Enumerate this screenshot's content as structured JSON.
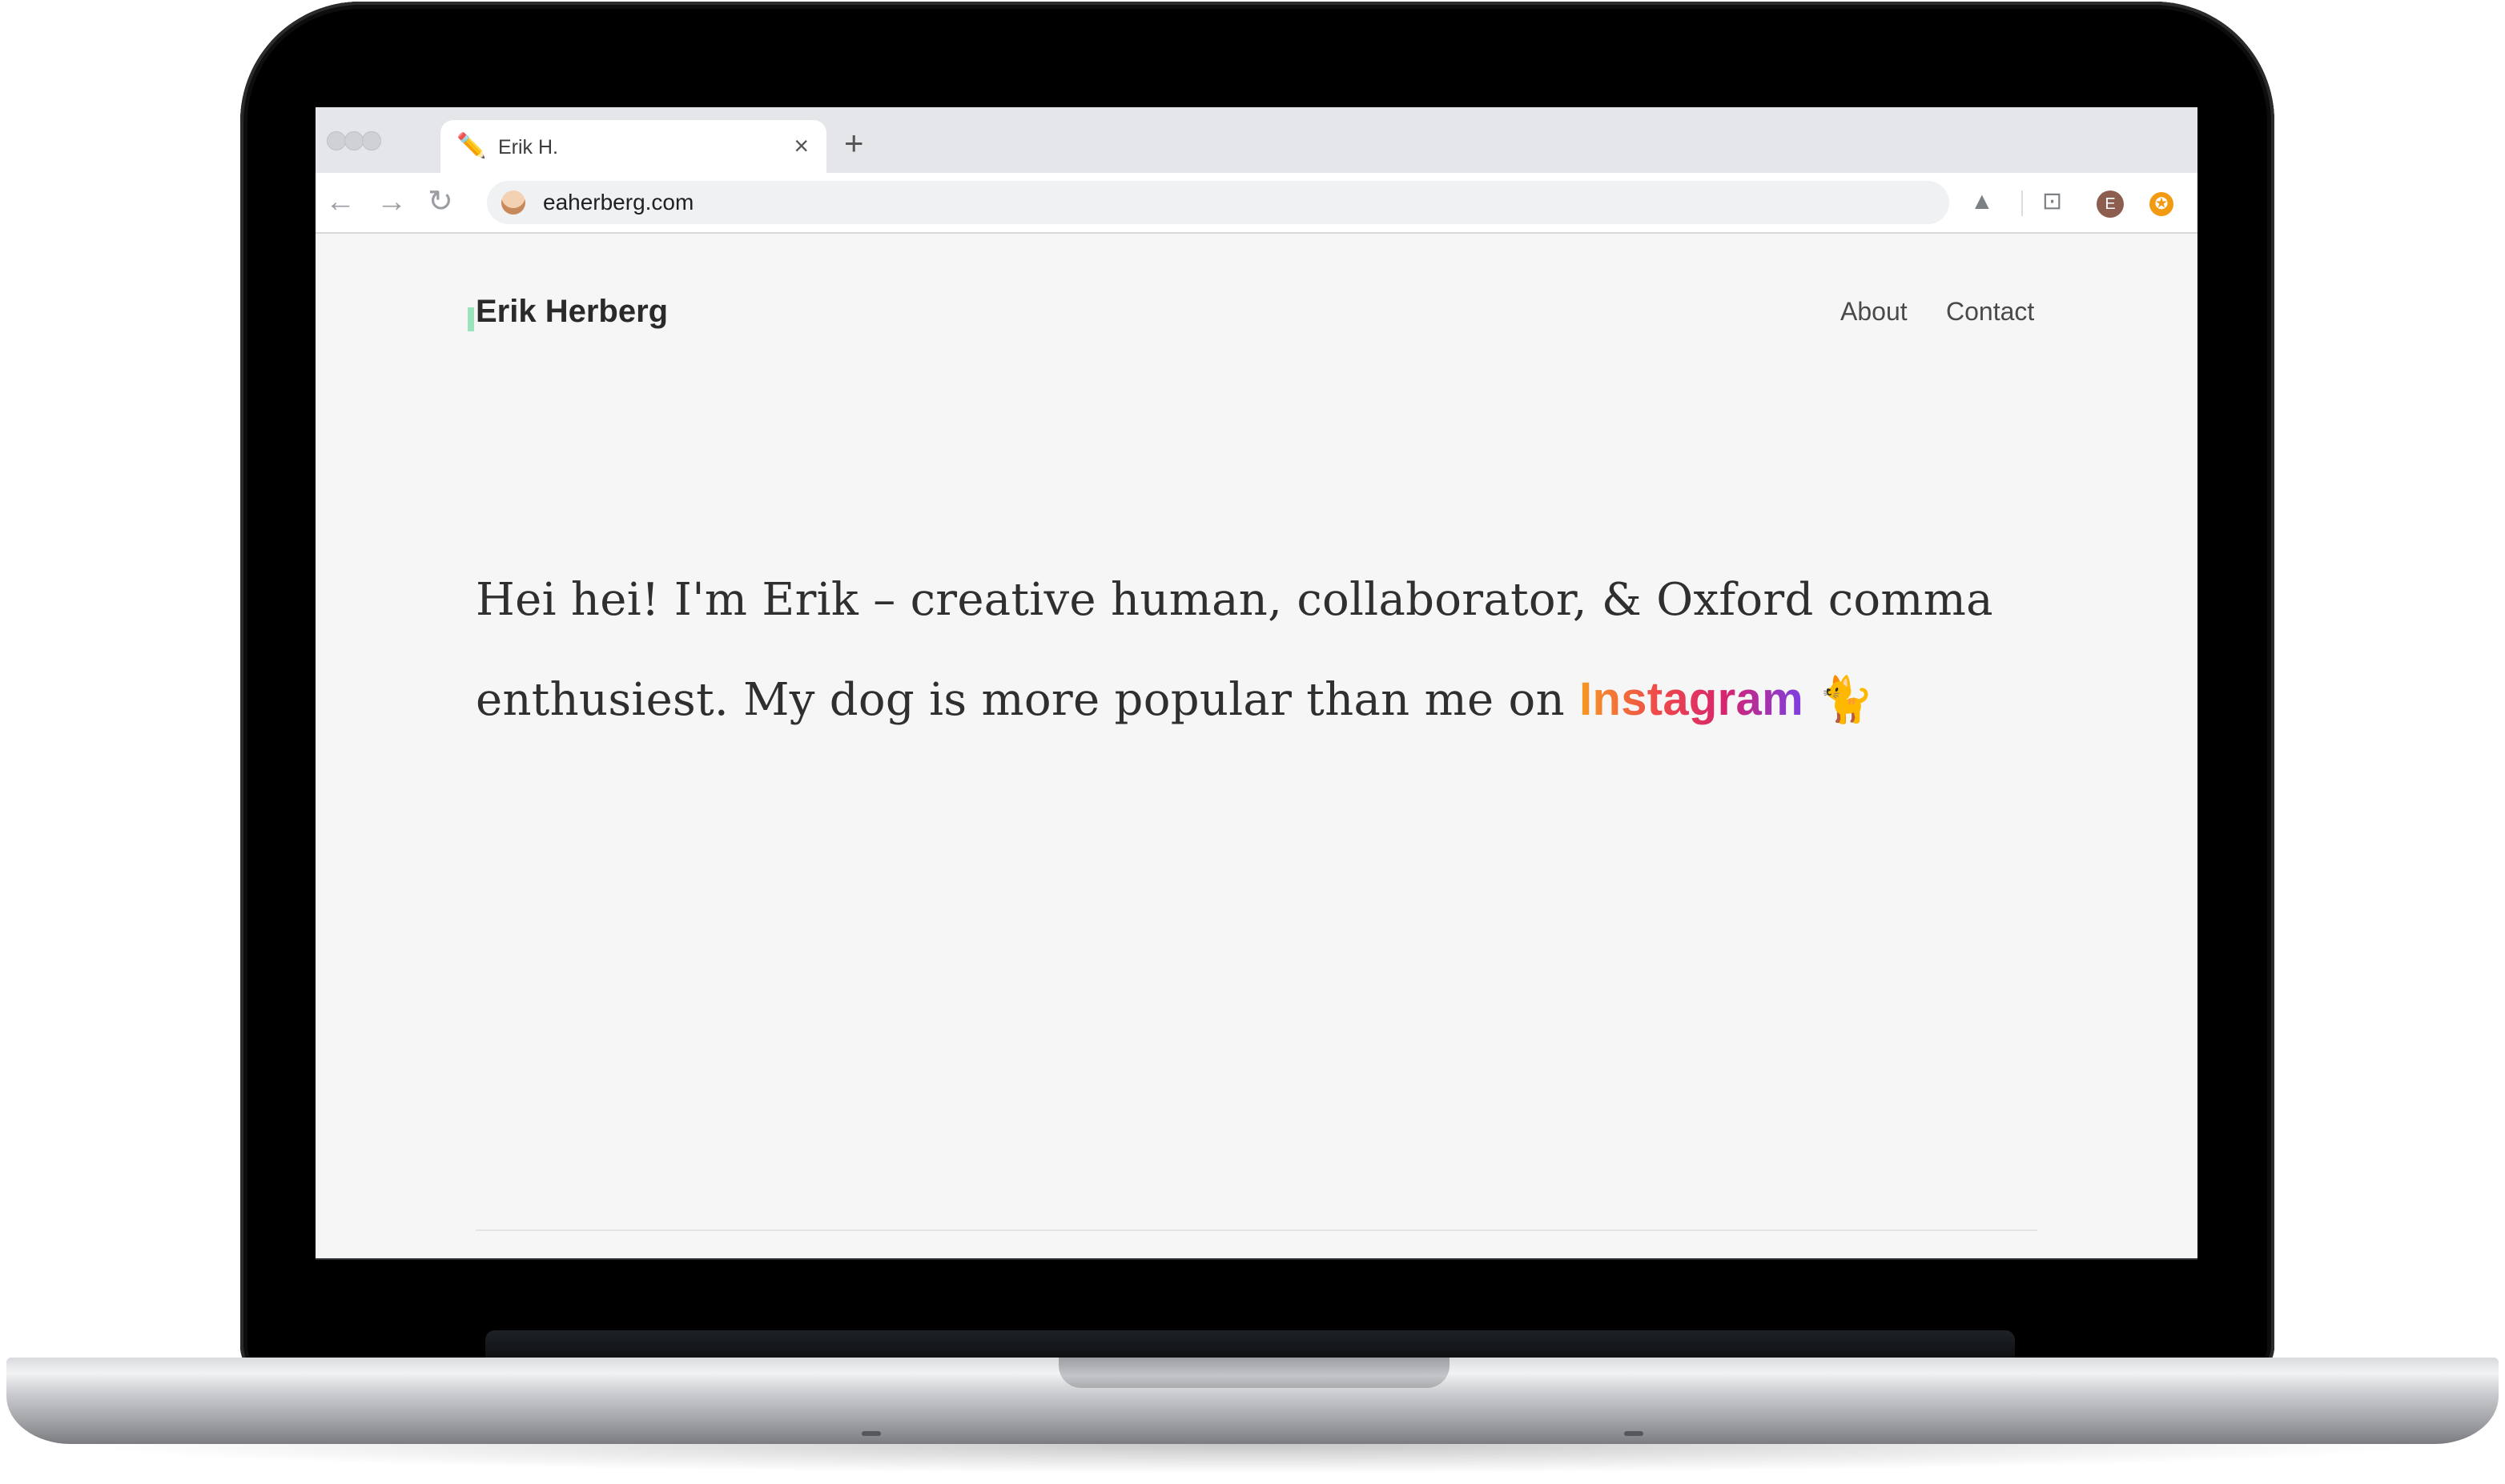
{
  "browser": {
    "tab": {
      "favicon": "✏️",
      "title": "Erik H.",
      "close": "×"
    },
    "new_tab": "+",
    "nav": {
      "back": "←",
      "forward": "→",
      "reload": "↻"
    },
    "address": "eaherberg.com",
    "extensions": {
      "drive": "▲",
      "cast": "⊡",
      "profile_initial": "E",
      "badge": "✪"
    }
  },
  "site": {
    "brand": "Erik Herberg",
    "nav": [
      "About",
      "Contact"
    ],
    "hero": {
      "text": "Hei hei! I'm Erik – creative human, collaborator, & Oxford comma enthusiest. My dog is more popular than me on ",
      "link": "Instagram",
      "emoji": "🐈"
    }
  },
  "colors": {
    "instagram_gradient": [
      "#f59a23",
      "#ef4a4a",
      "#d6246e",
      "#7b3fe4"
    ],
    "page_bg": "#f6f6f6",
    "brand_accent": "#9be2bd"
  }
}
